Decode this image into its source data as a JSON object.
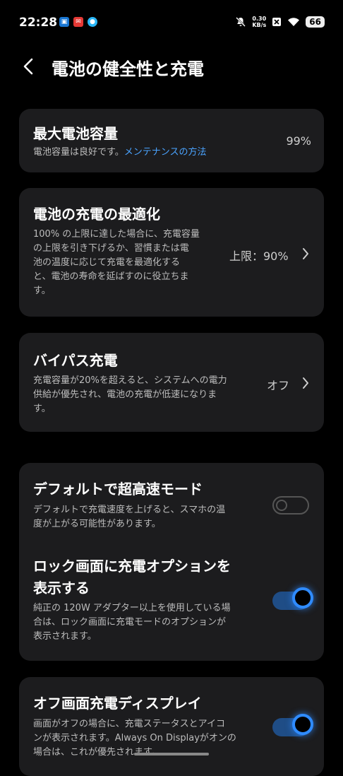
{
  "status": {
    "time": "22:28",
    "speed_value": "0.30",
    "speed_unit": "KB/s",
    "battery": "66"
  },
  "header": {
    "title": "電池の健全性と充電"
  },
  "max_capacity": {
    "title": "最大電池容量",
    "desc": "電池容量は良好です。",
    "link": "メンテナンスの方法",
    "value": "99%"
  },
  "optimization": {
    "title": "電池の充電の最適化",
    "desc_lines": [
      "100% の上限に達した場合に、充電容量",
      "の上限を引き下げるか、習慣または電",
      "池の温度に応じて充電を最適化する",
      "と、電池の寿命を延ばすのに役立ちま",
      "す。"
    ],
    "value": "上限：90%"
  },
  "bypass": {
    "title": "バイパス充電",
    "desc_lines": [
      "充電容量が20%を超えると、システムへの電力",
      "供給が優先され、電池の充電が低速になりま",
      "す。"
    ],
    "value": "オフ"
  },
  "super_fast": {
    "title": "デフォルトで超高速モード",
    "desc_lines": [
      "デフォルトで充電速度を上げると、スマホの温",
      "度が上がる可能性があります。"
    ],
    "enabled": false
  },
  "lock_screen": {
    "title_lines": [
      "ロック画面に充電オプションを",
      "表示する"
    ],
    "desc_lines": [
      "純正の 120W アダプター以上を使用している場",
      "合は、ロック画面に充電モードのオプションが",
      "表示されます。"
    ],
    "enabled": true
  },
  "off_screen": {
    "title": "オフ画面充電ディスプレイ",
    "desc_lines": [
      "画面がオフの場合に、充電ステータスとアイコ",
      "ンが表示されます。Always On Displayがオンの",
      "場合は、これが優先されます。"
    ],
    "enabled": true
  },
  "colors": {
    "accent": "#2f8bff",
    "card": "#1c1c1e",
    "link": "#4aa3ff"
  }
}
